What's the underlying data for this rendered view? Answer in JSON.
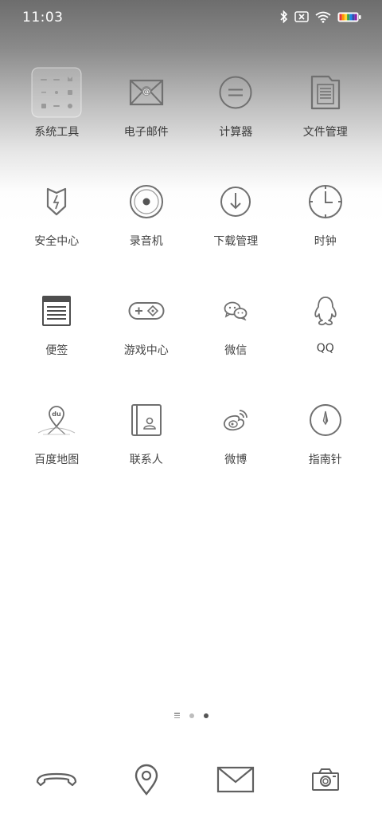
{
  "status_bar": {
    "time": "11:03",
    "icons": [
      "bluetooth-icon",
      "sim-no-signal-icon",
      "wifi-icon",
      "battery-icon"
    ]
  },
  "apps": [
    {
      "label": "系统工具",
      "icon": "system-tools-folder-icon"
    },
    {
      "label": "电子邮件",
      "icon": "email-icon"
    },
    {
      "label": "计算器",
      "icon": "calculator-icon"
    },
    {
      "label": "文件管理",
      "icon": "file-manager-icon"
    },
    {
      "label": "安全中心",
      "icon": "security-shield-icon"
    },
    {
      "label": "录音机",
      "icon": "recorder-icon"
    },
    {
      "label": "下载管理",
      "icon": "download-icon"
    },
    {
      "label": "时钟",
      "icon": "clock-icon"
    },
    {
      "label": "便签",
      "icon": "notes-icon"
    },
    {
      "label": "游戏中心",
      "icon": "gamepad-icon"
    },
    {
      "label": "微信",
      "icon": "wechat-icon"
    },
    {
      "label": "QQ",
      "icon": "qq-penguin-icon"
    },
    {
      "label": "百度地图",
      "icon": "baidu-map-icon"
    },
    {
      "label": "联系人",
      "icon": "contacts-icon"
    },
    {
      "label": "微博",
      "icon": "weibo-icon"
    },
    {
      "label": "指南针",
      "icon": "compass-icon"
    }
  ],
  "page_indicator": {
    "pages": 3,
    "active": 3
  },
  "dock": [
    {
      "icon": "phone-icon"
    },
    {
      "icon": "location-pin-icon"
    },
    {
      "icon": "mail-envelope-icon"
    },
    {
      "icon": "camera-icon"
    }
  ]
}
